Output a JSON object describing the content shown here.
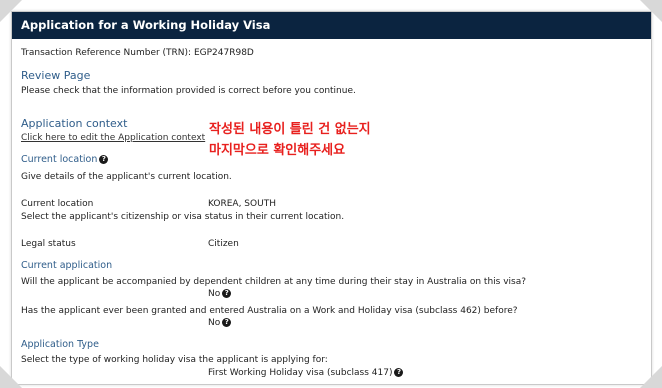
{
  "window": {
    "title": "Application for a Working Holiday Visa"
  },
  "trn": {
    "label": "Transaction Reference Number (TRN): EGP247R98D"
  },
  "review": {
    "title": "Review Page",
    "instructions": "Please check that the information provided is correct before you continue."
  },
  "application_context": {
    "title": "Application context",
    "edit_link": "Click here to edit the Application context"
  },
  "current_location": {
    "title": "Current location",
    "description": "Give details of the applicant's current location.",
    "location_label": "Current location",
    "location_value": "KOREA, SOUTH",
    "citizenship_prompt": "Select the applicant's citizenship or visa status in their current location.",
    "legal_status_label": "Legal status",
    "legal_status_value": "Citizen"
  },
  "current_application": {
    "title": "Current application",
    "q1": "Will the applicant be accompanied by dependent children at any time during their stay in Australia on this visa?",
    "a1": "No",
    "q2": "Has the applicant ever been granted and entered Australia on a Work and Holiday visa (subclass 462) before?",
    "a2": "No"
  },
  "application_type": {
    "title": "Application Type",
    "prompt": "Select the type of working holiday visa the applicant is applying for:",
    "value": "First Working Holiday visa (subclass 417)"
  },
  "annotation": {
    "line1": "작성된 내용이 틀린 건 없는지",
    "line2": "마지막으로 확인해주세요",
    "color": "#e8201e"
  },
  "icons": {
    "help": "help-icon",
    "help_glyph": "?"
  },
  "colors": {
    "titlebar": "#0b2440",
    "heading": "#2f5d8a"
  }
}
